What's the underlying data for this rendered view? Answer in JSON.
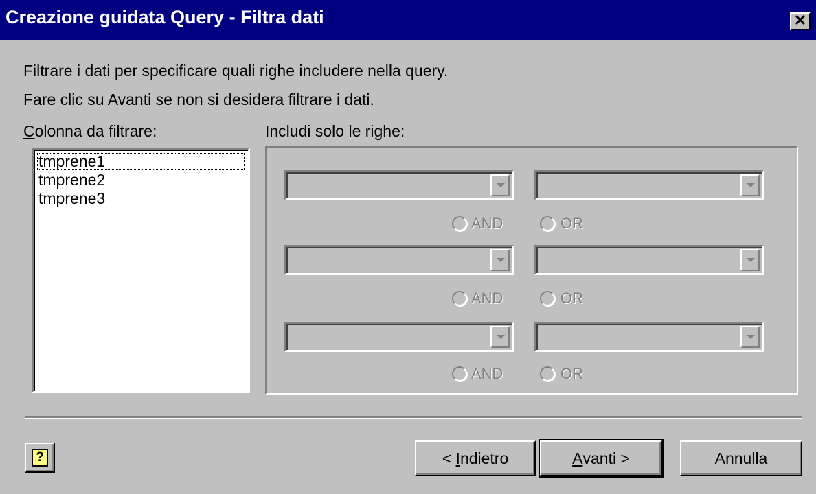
{
  "window": {
    "title": "Creazione guidata Query - Filtra dati",
    "close_glyph": "✕"
  },
  "instructions": {
    "line1": "Filtrare i dati per specificare quali righe includere nella query.",
    "line2": "Fare clic su Avanti se non si desidera filtrare i dati."
  },
  "column_list": {
    "label_mnemonic": "C",
    "label_rest": "olonna da filtrare:",
    "items": [
      "tmprene1",
      "tmprene2",
      "tmprene3"
    ],
    "selected": "tmprene1"
  },
  "filter_group": {
    "label": "Includi solo le righe:",
    "rows": [
      {
        "operator_value": "",
        "value_value": "",
        "and_label": "AND",
        "or_label": "OR"
      },
      {
        "operator_value": "",
        "value_value": "",
        "and_label": "AND",
        "or_label": "OR"
      },
      {
        "operator_value": "",
        "value_value": "",
        "and_label": "AND",
        "or_label": "OR"
      }
    ],
    "disabled_color": "#808080"
  },
  "buttons": {
    "help_glyph": "?",
    "back_prefix": "< ",
    "back_mnemonic": "I",
    "back_rest": "ndietro",
    "next_mnemonic": "A",
    "next_rest": "vanti >",
    "cancel": "Annulla"
  },
  "colors": {
    "titlebar": "#000080",
    "face": "#c0c0c0"
  }
}
